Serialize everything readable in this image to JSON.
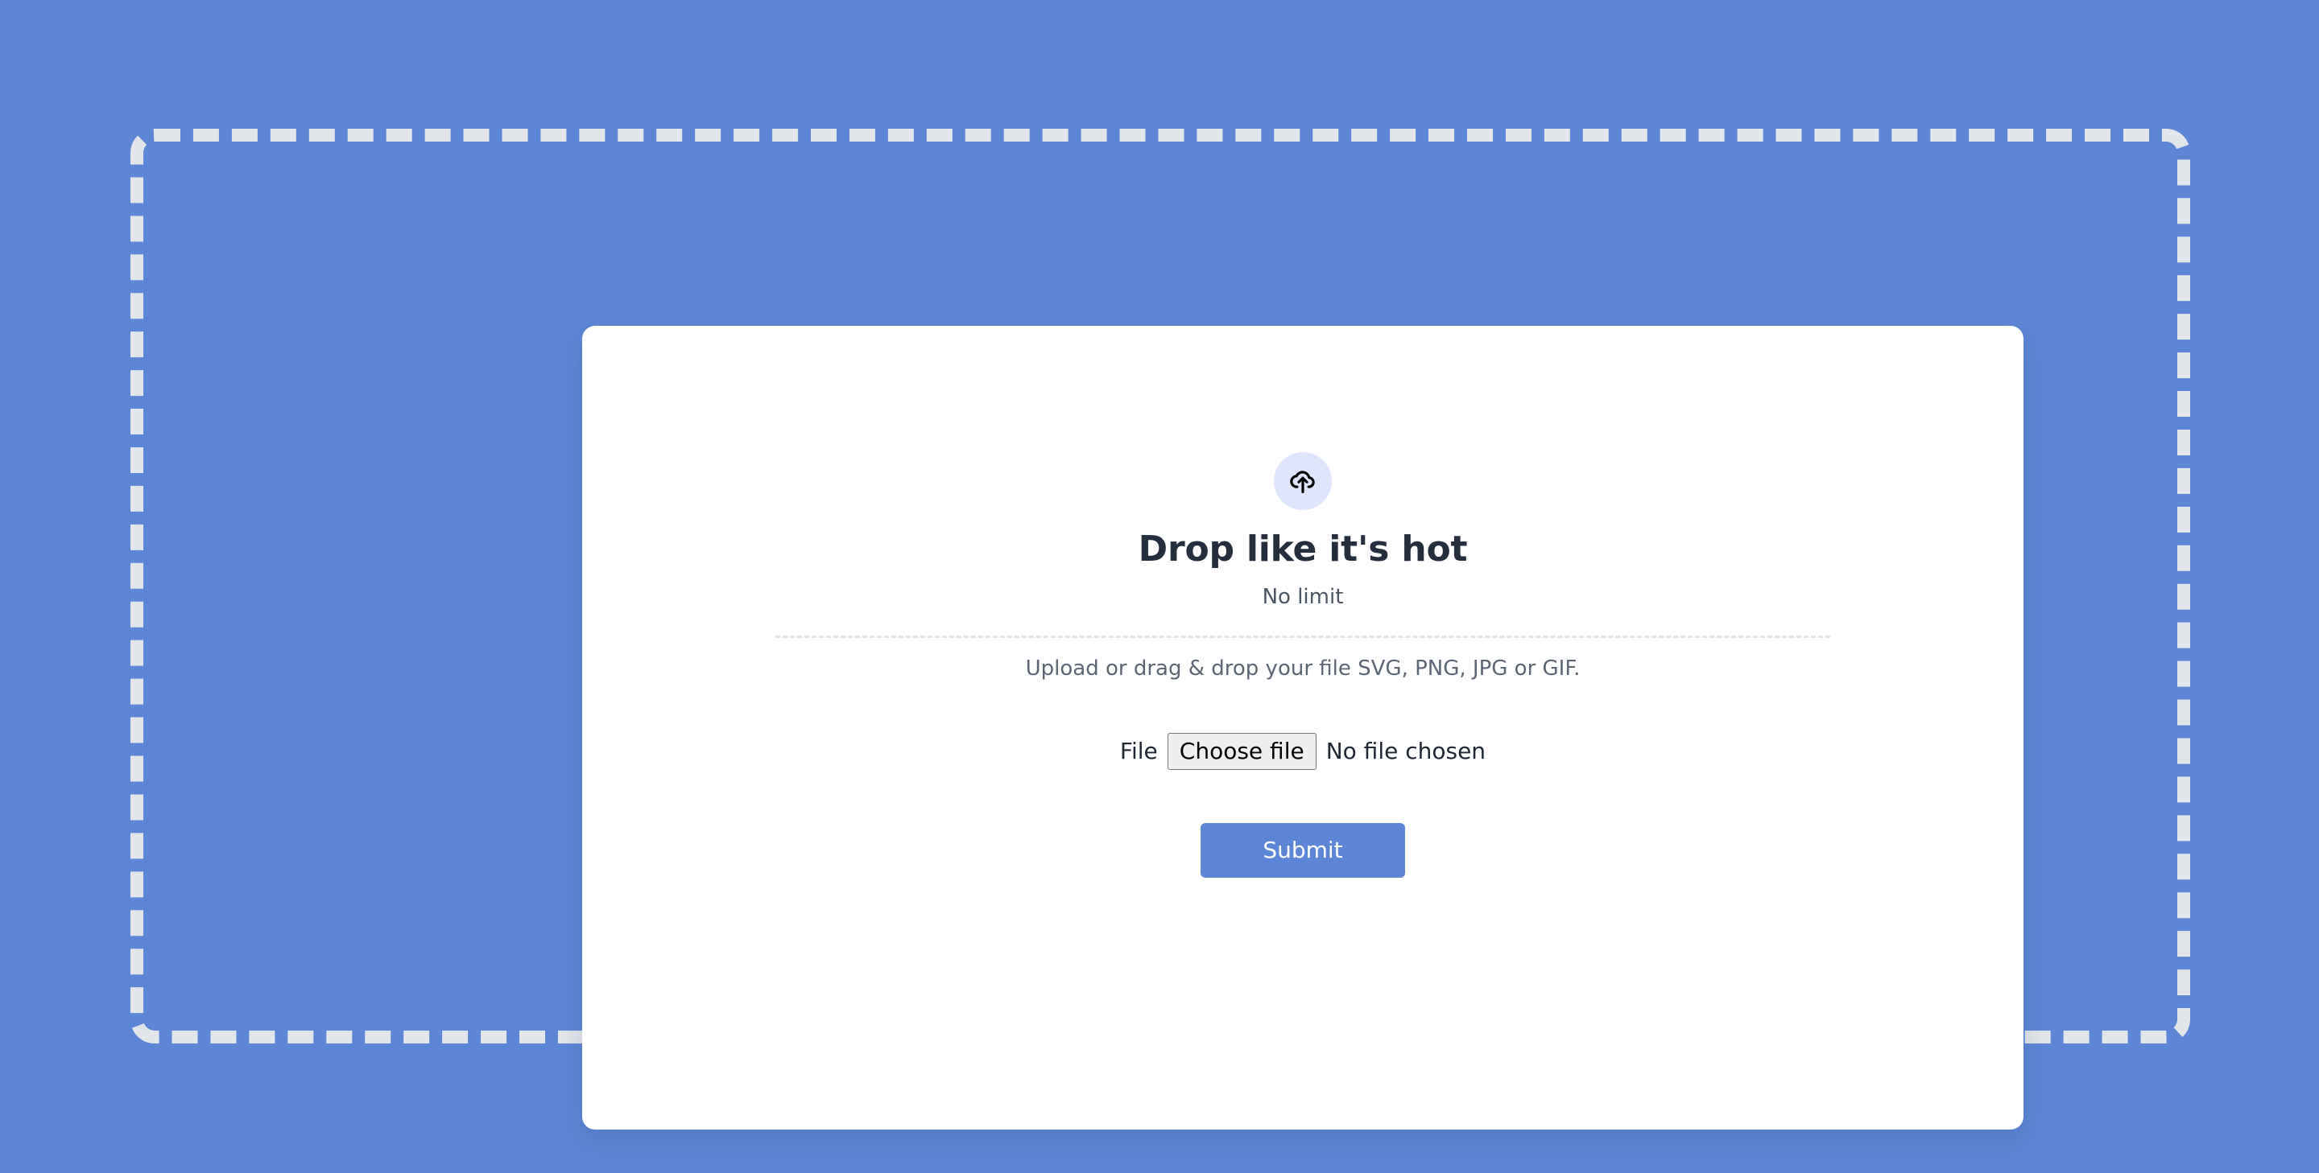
{
  "theme": {
    "page_background": "#5d87d6",
    "dropzone_border": "#e2e5ea",
    "card_background": "#ffffff",
    "icon_badge_background": "#dfe6fb",
    "title_color": "#252e3d",
    "muted_text_color": "#5c6574",
    "accent": "#5d87d6"
  },
  "dropzone": {
    "icon": "cloud-upload-icon",
    "title": "Drop like it's hot",
    "subtitle": "No limit",
    "hint": "Upload or drag & drop your file SVG, PNG, JPG or GIF.",
    "file_input": {
      "label": "File",
      "button_label": "Choose file",
      "status": "No file chosen"
    },
    "submit_label": "Submit"
  }
}
